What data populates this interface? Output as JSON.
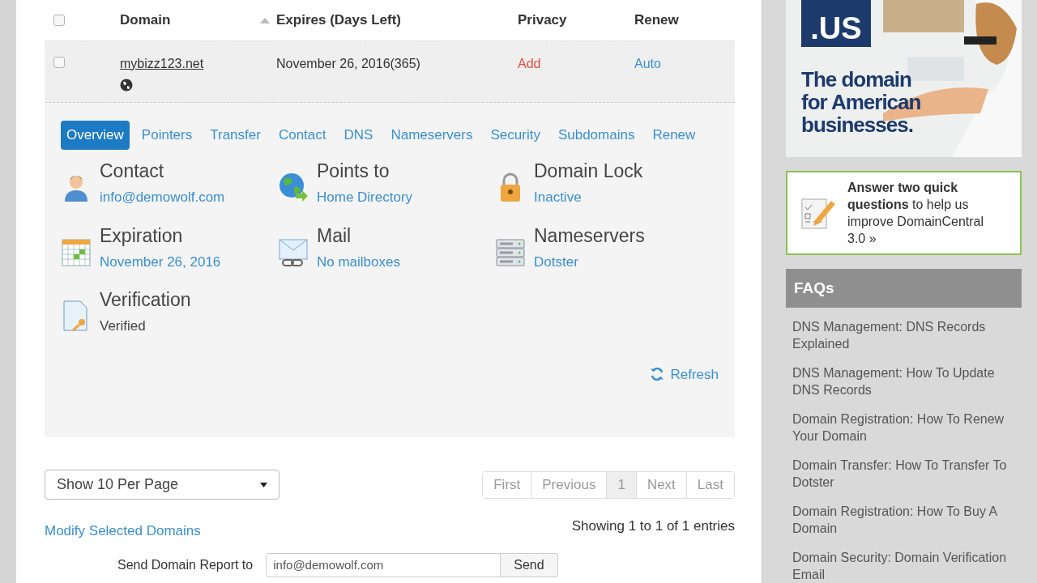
{
  "table": {
    "select_all": {
      "checked": false
    },
    "columns": [
      {
        "label": "Domain",
        "sorted": true
      },
      {
        "label": "Expires (Days Left)",
        "sorted": false
      },
      {
        "label": "Privacy",
        "sorted": false
      },
      {
        "label": "Renew",
        "sorted": false
      }
    ],
    "rows": [
      {
        "checked": false,
        "domain": "mybizz123.net",
        "expires": "November 26, 2016(365)",
        "privacy": "Add",
        "renew": "Auto",
        "expanded": true
      }
    ]
  },
  "detail": {
    "tabs": [
      {
        "label": "Overview",
        "selected": true
      },
      {
        "label": "Pointers",
        "selected": false
      },
      {
        "label": "Transfer",
        "selected": false
      },
      {
        "label": "Contact",
        "selected": false
      },
      {
        "label": "DNS",
        "selected": false
      },
      {
        "label": "Nameservers",
        "selected": false
      },
      {
        "label": "Security",
        "selected": false
      },
      {
        "label": "Subdomains",
        "selected": false
      },
      {
        "label": "Renew",
        "selected": false
      }
    ],
    "items": [
      {
        "kind": "contact",
        "title": "Contact",
        "value": "info@demowolf.com",
        "link": true
      },
      {
        "kind": "points",
        "title": "Points to",
        "value": "Home Directory",
        "link": true
      },
      {
        "kind": "lock",
        "title": "Domain Lock",
        "value": "Inactive",
        "link": true
      },
      {
        "kind": "calendar",
        "title": "Expiration",
        "value": "November 26, 2016",
        "link": true
      },
      {
        "kind": "mail",
        "title": "Mail",
        "value": "No mailboxes",
        "link": true
      },
      {
        "kind": "servers",
        "title": "Nameservers",
        "value": "Dotster",
        "link": true
      },
      {
        "kind": "verify",
        "title": "Verification",
        "value": "Verified",
        "link": false
      }
    ],
    "refresh": "Refresh"
  },
  "per_page": "Show 10 Per Page",
  "pagination": [
    {
      "label": "First",
      "selected": false
    },
    {
      "label": "Previous",
      "selected": false
    },
    {
      "label": "1",
      "selected": true
    },
    {
      "label": "Next",
      "selected": false
    },
    {
      "label": "Last",
      "selected": false
    }
  ],
  "modify_link": "Modify Selected Domains",
  "showing": "Showing 1 to 1 of 1 entries",
  "report": {
    "label": "Send Domain Report to",
    "email": "info@demowolf.com",
    "button": "Send"
  },
  "sidebar": {
    "ad": {
      "badge": ".US",
      "headline": "The domain for American businesses."
    },
    "survey": "**Answer two quick questions** to help us improve DomainCentral 3.0 »",
    "faq_title": "FAQs",
    "faqs": [
      "DNS Management: DNS Records Explained",
      "DNS Management: How To Update DNS Records",
      "Domain Registration: How To Renew Your Domain",
      "Domain Transfer: How To Transfer To Dotster",
      "Domain Registration: How To Buy A Domain",
      "Domain Security: Domain Verification Email"
    ]
  }
}
